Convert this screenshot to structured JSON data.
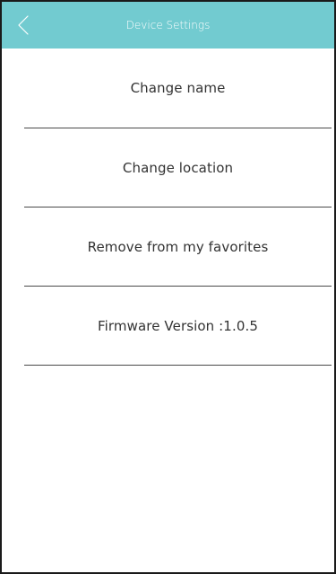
{
  "header": {
    "title": "Device Settings",
    "back_icon": "chevron-left-icon",
    "background_color": "#72cbd0"
  },
  "menu": {
    "items": [
      {
        "label": "Change name"
      },
      {
        "label": "Change location"
      },
      {
        "label": "Remove from my favorites"
      },
      {
        "label": "Firmware Version :1.0.5"
      }
    ]
  }
}
